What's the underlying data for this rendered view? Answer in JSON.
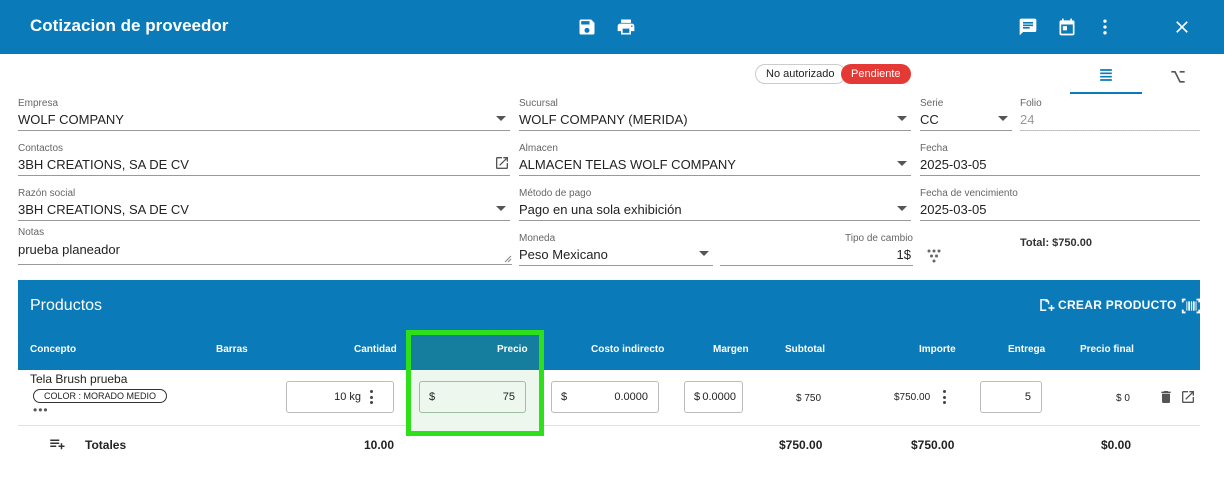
{
  "appbar": {
    "title": "Cotizacion de proveedor",
    "icons": [
      "save-icon",
      "print-icon",
      "comment-icon",
      "calendar-icon",
      "more-vert-icon",
      "close-icon"
    ]
  },
  "status": {
    "authorization": "No autorizado",
    "state": "Pendiente"
  },
  "form": {
    "empresa": {
      "label": "Empresa",
      "value": "WOLF COMPANY"
    },
    "sucursal": {
      "label": "Sucursal",
      "value": "WOLF COMPANY (MERIDA)"
    },
    "serie": {
      "label": "Serie",
      "value": "CC"
    },
    "folio": {
      "label": "Folio",
      "value": "24"
    },
    "contactos": {
      "label": "Contactos",
      "value": "3BH CREATIONS, SA DE CV"
    },
    "almacen": {
      "label": "Almacen",
      "value": "ALMACEN TELAS WOLF COMPANY"
    },
    "fecha": {
      "label": "Fecha",
      "value": "2025-03-05"
    },
    "razon": {
      "label": "Razón social",
      "value": "3BH CREATIONS, SA DE CV"
    },
    "metodo": {
      "label": "Método de pago",
      "value": "Pago en una sola exhibición"
    },
    "vencimiento": {
      "label": "Fecha de vencimiento",
      "value": "2025-03-05"
    },
    "notas": {
      "label": "Notas",
      "value": "prueba planeador"
    },
    "moneda": {
      "label": "Moneda",
      "value": "Peso Mexicano"
    },
    "tipo_cambio": {
      "label": "Tipo de cambio",
      "value": "1$"
    },
    "total": "Total: $750.00"
  },
  "productos": {
    "title": "Productos",
    "crear_label": "CREAR PRODUCTO",
    "columns": {
      "concepto": "Concepto",
      "barras": "Barras",
      "cantidad": "Cantidad",
      "precio": "Precio",
      "costo": "Costo indirecto",
      "margen": "Margen",
      "subtotal": "Subtotal",
      "importe": "Importe",
      "entrega": "Entrega",
      "precio_final": "Precio final"
    },
    "row": {
      "concepto": "Tela Brush prueba",
      "attribute": "COLOR : MORADO MEDIO",
      "more": "•••",
      "cantidad": "10 kg",
      "precio_prefix": "$",
      "precio": "75",
      "costo_prefix": "$",
      "costo": "0.0000",
      "margen_prefix": "$",
      "margen": "0.0000",
      "subtotal": "$ 750",
      "importe": "$750.00",
      "entrega": "5",
      "precio_final": "$ 0"
    },
    "totals": {
      "label": "Totales",
      "cantidad": "10.00",
      "subtotal": "$750.00",
      "importe": "$750.00",
      "precio_final": "$0.00"
    }
  }
}
